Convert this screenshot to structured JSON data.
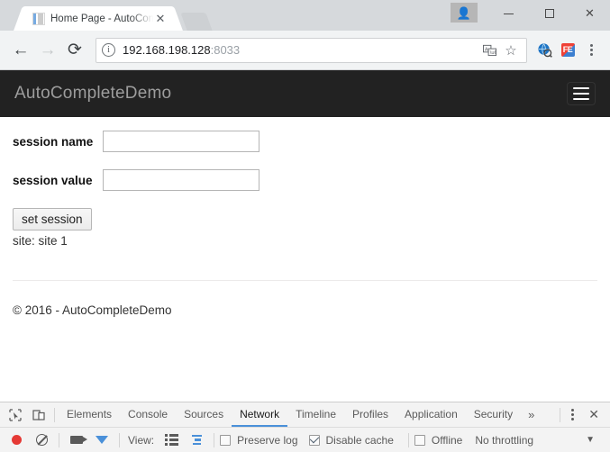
{
  "browser": {
    "tab": {
      "title": "Home Page - AutoComp",
      "close_label": "✕",
      "favicon": "page-favicon"
    },
    "new_tab_label": "+",
    "window_controls": {
      "avatar": "👤",
      "minimize": "–",
      "maximize": "□",
      "close": "✕"
    },
    "nav": {
      "back": "←",
      "forward": "→",
      "reload": "⟳"
    },
    "omnibox": {
      "security_icon": "ⓘ",
      "url_host": "192.168.198.128",
      "url_port": ":8033",
      "translate_icon": "文",
      "bookmark_icon": "☆"
    },
    "extensions": [
      {
        "name": "extension-blue-globe",
        "glyph": "🌐"
      },
      {
        "name": "extension-fe",
        "glyph": "FE"
      }
    ],
    "menu_icon": "chrome-menu-icon"
  },
  "page": {
    "navbar": {
      "brand": "AutoCompleteDemo",
      "toggle": "navbar-toggle"
    },
    "form": {
      "fields": [
        {
          "label": "session name",
          "value": "",
          "placeholder": ""
        },
        {
          "label": "session value",
          "value": "",
          "placeholder": ""
        }
      ],
      "submit_label": "set session"
    },
    "site_text": "site: site 1",
    "footer": "© 2016 - AutoCompleteDemo"
  },
  "devtools": {
    "inspect_icon": "inspect-element-icon",
    "device_icon": "device-toolbar-icon",
    "tabs": [
      {
        "label": "Elements",
        "active": false
      },
      {
        "label": "Console",
        "active": false
      },
      {
        "label": "Sources",
        "active": false
      },
      {
        "label": "Network",
        "active": true
      },
      {
        "label": "Timeline",
        "active": false
      },
      {
        "label": "Profiles",
        "active": false
      },
      {
        "label": "Application",
        "active": false
      },
      {
        "label": "Security",
        "active": false
      }
    ],
    "more_tabs": "»",
    "close_label": "✕",
    "toolbar": {
      "record": "record-button",
      "clear": "clear-button",
      "camera": "capture-screenshots-button",
      "filter": "filter-button",
      "view_label": "View:",
      "view_list": "list-view-icon",
      "view_waterfall": "waterfall-view-icon",
      "preserve_log": {
        "label": "Preserve log",
        "checked": false
      },
      "disable_cache": {
        "label": "Disable cache",
        "checked": true
      },
      "offline": {
        "label": "Offline",
        "checked": false
      },
      "throttling": "No throttling",
      "throttling_caret": "▼"
    }
  }
}
